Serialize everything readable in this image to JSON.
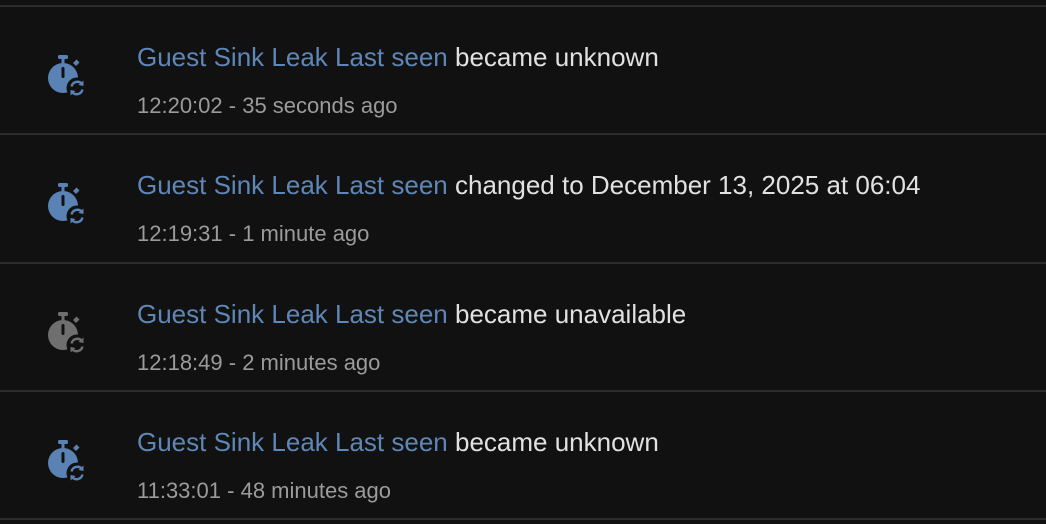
{
  "colors": {
    "background": "#111111",
    "divider": "#2c2c2c",
    "entity_link": "#5e86b6",
    "message_text": "#e1e1e1",
    "meta_text": "#9b9b9b",
    "icon_active": "#5a82b4",
    "icon_unavailable": "#6f6f6f"
  },
  "entries": [
    {
      "icon": "timer-sync-icon",
      "icon_state": "active",
      "entity": "Guest Sink Leak Last seen",
      "message": "became unknown",
      "time": "12:20:02",
      "separator": " - ",
      "relative": "35 seconds ago"
    },
    {
      "icon": "timer-sync-icon",
      "icon_state": "active",
      "entity": "Guest Sink Leak Last seen",
      "message": "changed to December 13, 2025 at 06:04",
      "time": "12:19:31",
      "separator": " - ",
      "relative": "1 minute ago"
    },
    {
      "icon": "timer-sync-icon",
      "icon_state": "unavailable",
      "entity": "Guest Sink Leak Last seen",
      "message": "became unavailable",
      "time": "12:18:49",
      "separator": " - ",
      "relative": "2 minutes ago"
    },
    {
      "icon": "timer-sync-icon",
      "icon_state": "active",
      "entity": "Guest Sink Leak Last seen",
      "message": "became unknown",
      "time": "11:33:01",
      "separator": " - ",
      "relative": "48 minutes ago"
    }
  ]
}
